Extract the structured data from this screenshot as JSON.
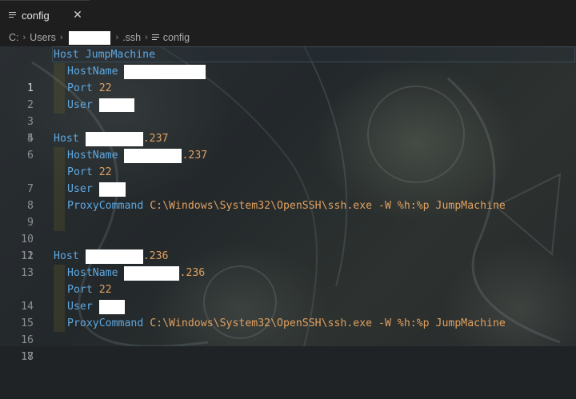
{
  "tab": {
    "label": "config",
    "close": "✕"
  },
  "breadcrumb": {
    "drive": "C:",
    "users": "Users",
    "ssh": ".ssh",
    "file": "config"
  },
  "editor": {
    "line_numbers": [
      "1",
      "2",
      "3",
      "4",
      "5",
      "6",
      "7",
      "8",
      "9",
      "10",
      "11",
      "12",
      "13",
      "14",
      "15",
      "16",
      "17",
      "18"
    ],
    "lines": {
      "l1": {
        "keyword": "Host",
        "value": "JumpMachine"
      },
      "l2": {
        "keyword": "HostName"
      },
      "l3": {
        "keyword": "Port",
        "value": "22"
      },
      "l4": {
        "keyword": "User"
      },
      "l6": {
        "keyword": "Host",
        "suffix": ".237"
      },
      "l7": {
        "keyword": "HostName",
        "suffix": ".237"
      },
      "l8": {
        "keyword": "Port",
        "value": "22"
      },
      "l9": {
        "keyword": "User"
      },
      "l10": {
        "keyword": "ProxyCommand",
        "value": "C:\\Windows\\System32\\OpenSSH\\ssh.exe -W %h:%p JumpMachine"
      },
      "l13": {
        "keyword": "Host",
        "suffix": ".236"
      },
      "l14": {
        "keyword": "HostName",
        "suffix": ".236"
      },
      "l15": {
        "keyword": "Port",
        "value": "22"
      },
      "l16": {
        "keyword": "User"
      },
      "l17": {
        "keyword": "ProxyCommand",
        "value": "C:\\Windows\\System32\\OpenSSH\\ssh.exe -W %h:%p JumpMachine"
      }
    }
  },
  "colors": {
    "keyword": "#5ea8e0",
    "value": "#e0a060",
    "background": "#1f2326"
  }
}
